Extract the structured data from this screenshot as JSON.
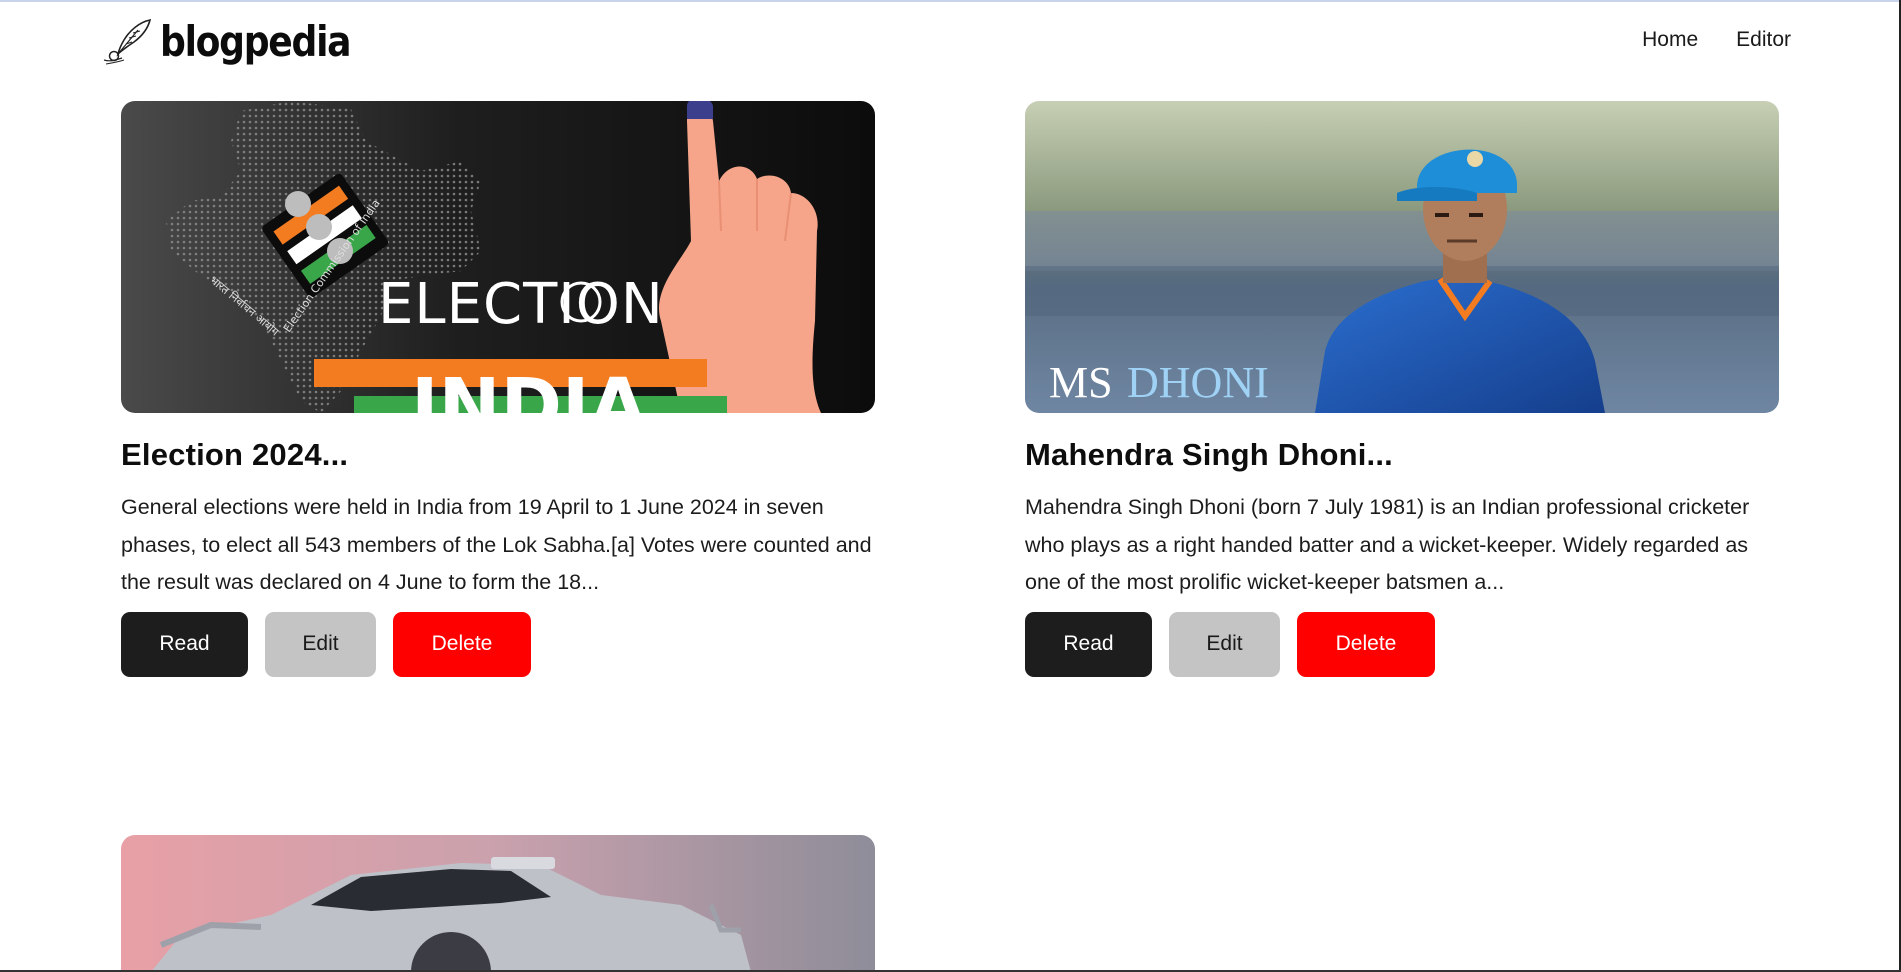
{
  "header": {
    "logo_text": "blogpedia",
    "nav": [
      {
        "label": "Home"
      },
      {
        "label": "Editor"
      }
    ]
  },
  "posts": [
    {
      "title": "Election 2024...",
      "description": "General elections were held in India from 19 April to 1 June 2024 in seven phases, to elect all 543 members of the Lok Sabha.[a] Votes were counted and the result was declared on 4 June to form the 18...",
      "image": {
        "word1": "ELECTION",
        "word2": "INDIA"
      },
      "actions": {
        "read": "Read",
        "edit": "Edit",
        "delete": "Delete"
      }
    },
    {
      "title": "Mahendra Singh Dhoni...",
      "description": "Mahendra Singh Dhoni (born 7 July 1981) is an Indian professional cricketer who plays as a right handed batter and a wicket-keeper. Widely regarded as one of the most prolific wicket-keeper batsmen a...",
      "image": {
        "caption_a": "MS",
        "caption_b": "DHONI"
      },
      "actions": {
        "read": "Read",
        "edit": "Edit",
        "delete": "Delete"
      }
    },
    {
      "title": "",
      "description": "",
      "image": {}
    }
  ],
  "colors": {
    "read_button": "#1d1d1d",
    "edit_button": "#c4c4c4",
    "delete_button": "#ff0000"
  }
}
